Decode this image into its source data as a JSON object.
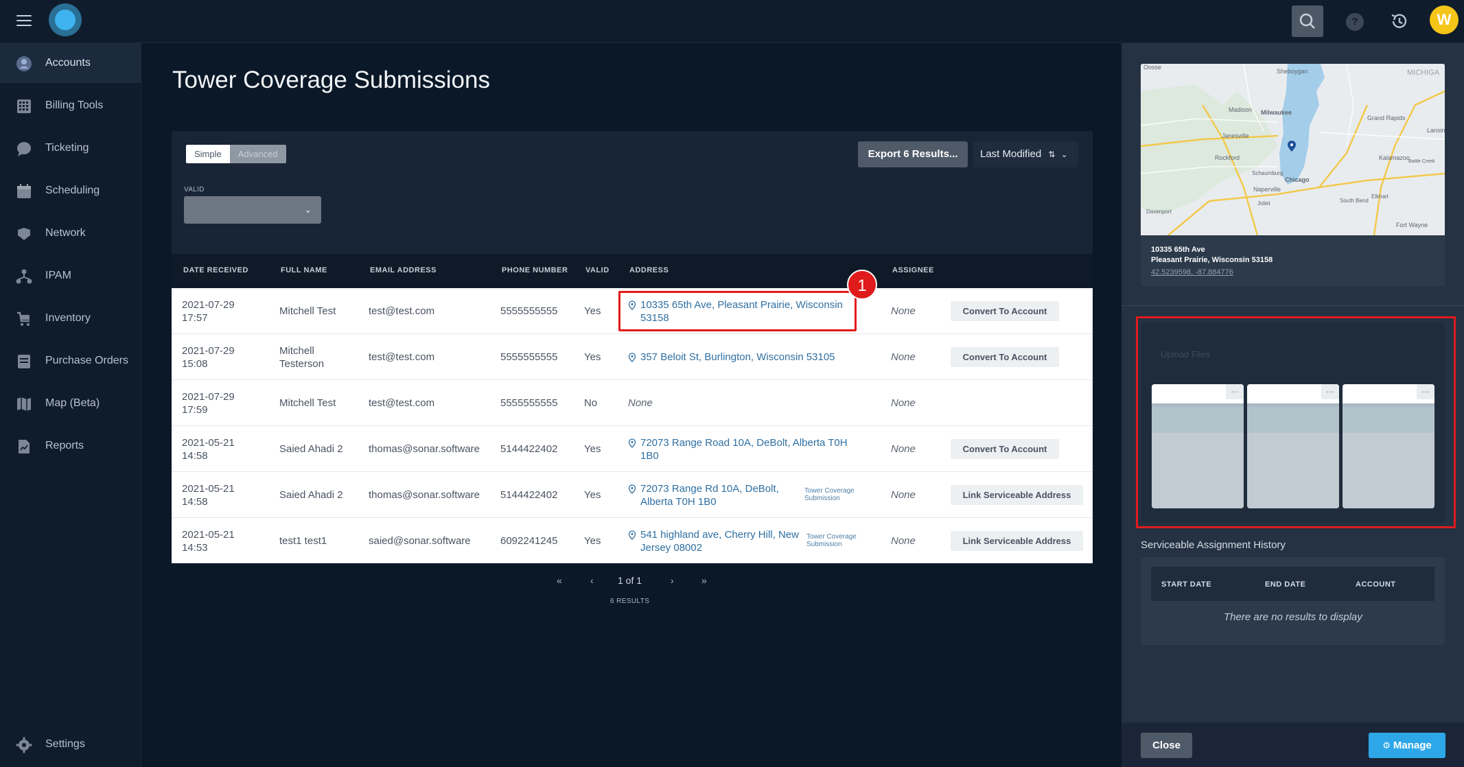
{
  "header": {
    "avatar_letter": "W"
  },
  "sidebar": {
    "items": [
      {
        "label": "Accounts",
        "icon": "user-circle-icon"
      },
      {
        "label": "Billing Tools",
        "icon": "calculator-icon"
      },
      {
        "label": "Ticketing",
        "icon": "chat-bubble-icon"
      },
      {
        "label": "Scheduling",
        "icon": "calendar-icon"
      },
      {
        "label": "Network",
        "icon": "network-icon"
      },
      {
        "label": "IPAM",
        "icon": "hierarchy-icon"
      },
      {
        "label": "Inventory",
        "icon": "cart-icon"
      },
      {
        "label": "Purchase Orders",
        "icon": "document-icon"
      },
      {
        "label": "Map (Beta)",
        "icon": "map-icon"
      },
      {
        "label": "Reports",
        "icon": "report-icon"
      }
    ],
    "settings_label": "Settings"
  },
  "page": {
    "title": "Tower Coverage Submissions"
  },
  "filters": {
    "simple_label": "Simple",
    "advanced_label": "Advanced",
    "valid_label": "VALID",
    "valid_value": "",
    "export_label": "Export 6 Results...",
    "sort_label": "Last Modified"
  },
  "table": {
    "headers": [
      "DATE RECEIVED",
      "FULL NAME",
      "EMAIL ADDRESS",
      "PHONE NUMBER",
      "VALID",
      "ADDRESS",
      "ASSIGNEE"
    ],
    "rows": [
      {
        "date": "2021-07-29",
        "time": "17:57",
        "name": "Mitchell Test",
        "email": "test@test.com",
        "phone": "5555555555",
        "valid": "Yes",
        "address": "10335 65th Ave, Pleasant Prairie, Wisconsin 53158",
        "tag": "",
        "assignee": "None",
        "action": "Convert To Account"
      },
      {
        "date": "2021-07-29",
        "time": "15:08",
        "name": "Mitchell Testerson",
        "email": "test@test.com",
        "phone": "5555555555",
        "valid": "Yes",
        "address": "357 Beloit St, Burlington, Wisconsin 53105",
        "tag": "",
        "assignee": "None",
        "action": "Convert To Account"
      },
      {
        "date": "2021-07-29",
        "time": "17:59",
        "name": "Mitchell Test",
        "email": "test@test.com",
        "phone": "5555555555",
        "valid": "No",
        "address": "None",
        "tag": "",
        "assignee": "None",
        "action": ""
      },
      {
        "date": "2021-05-21",
        "time": "14:58",
        "name": "Saied Ahadi 2",
        "email": "thomas@sonar.software",
        "phone": "5144422402",
        "valid": "Yes",
        "address": "72073 Range Road 10A, DeBolt, Alberta T0H 1B0",
        "tag": "",
        "assignee": "None",
        "action": "Convert To Account"
      },
      {
        "date": "2021-05-21",
        "time": "14:58",
        "name": "Saied Ahadi 2",
        "email": "thomas@sonar.software",
        "phone": "5144422402",
        "valid": "Yes",
        "address": "72073 Range Rd 10A, DeBolt, Alberta T0H 1B0",
        "tag": "Tower Coverage Submission",
        "assignee": "None",
        "action": "Link Serviceable Address"
      },
      {
        "date": "2021-05-21",
        "time": "14:53",
        "name": "test1 test1",
        "email": "saied@sonar.software",
        "phone": "6092241245",
        "valid": "Yes",
        "address": "541 highland ave, Cherry Hill, New Jersey 08002",
        "tag": "Tower Coverage Submission",
        "assignee": "None",
        "action": "Link Serviceable Address"
      }
    ]
  },
  "callout": {
    "number": "1"
  },
  "pagination": {
    "first": "«",
    "prev": "‹",
    "page_text": "1 of 1",
    "next": "›",
    "last": "»",
    "results_text": "6 RESULTS"
  },
  "detail": {
    "map_labels": [
      "Oosse",
      "Sheboygan",
      "MICHIGA",
      "Madison",
      "Milwaukee",
      "Grand Rapids",
      "Janesville",
      "Lansin",
      "Rockford",
      "Kalamazoo",
      "Battle Creek",
      "Chicago",
      "Naperville",
      "Schaumburg",
      "Joliet",
      "South Bend",
      "Elkhart",
      "Davenport",
      "Fort Wayne"
    ],
    "address_line1": "10335 65th Ave",
    "address_line2": "Pleasant Prairie, Wisconsin 53158",
    "coords": "42.5239598, -87.884776",
    "upload_title": "Upload Files",
    "history_title": "Serviceable Assignment History",
    "history_headers": [
      "START DATE",
      "END DATE",
      "ACCOUNT"
    ],
    "history_empty": "There are no results to display"
  },
  "footer": {
    "close_label": "Close",
    "manage_label": "Manage"
  },
  "colors": {
    "accent": "#2ea7e8",
    "highlight": "#e11b1b",
    "link": "#2f6fa1"
  }
}
